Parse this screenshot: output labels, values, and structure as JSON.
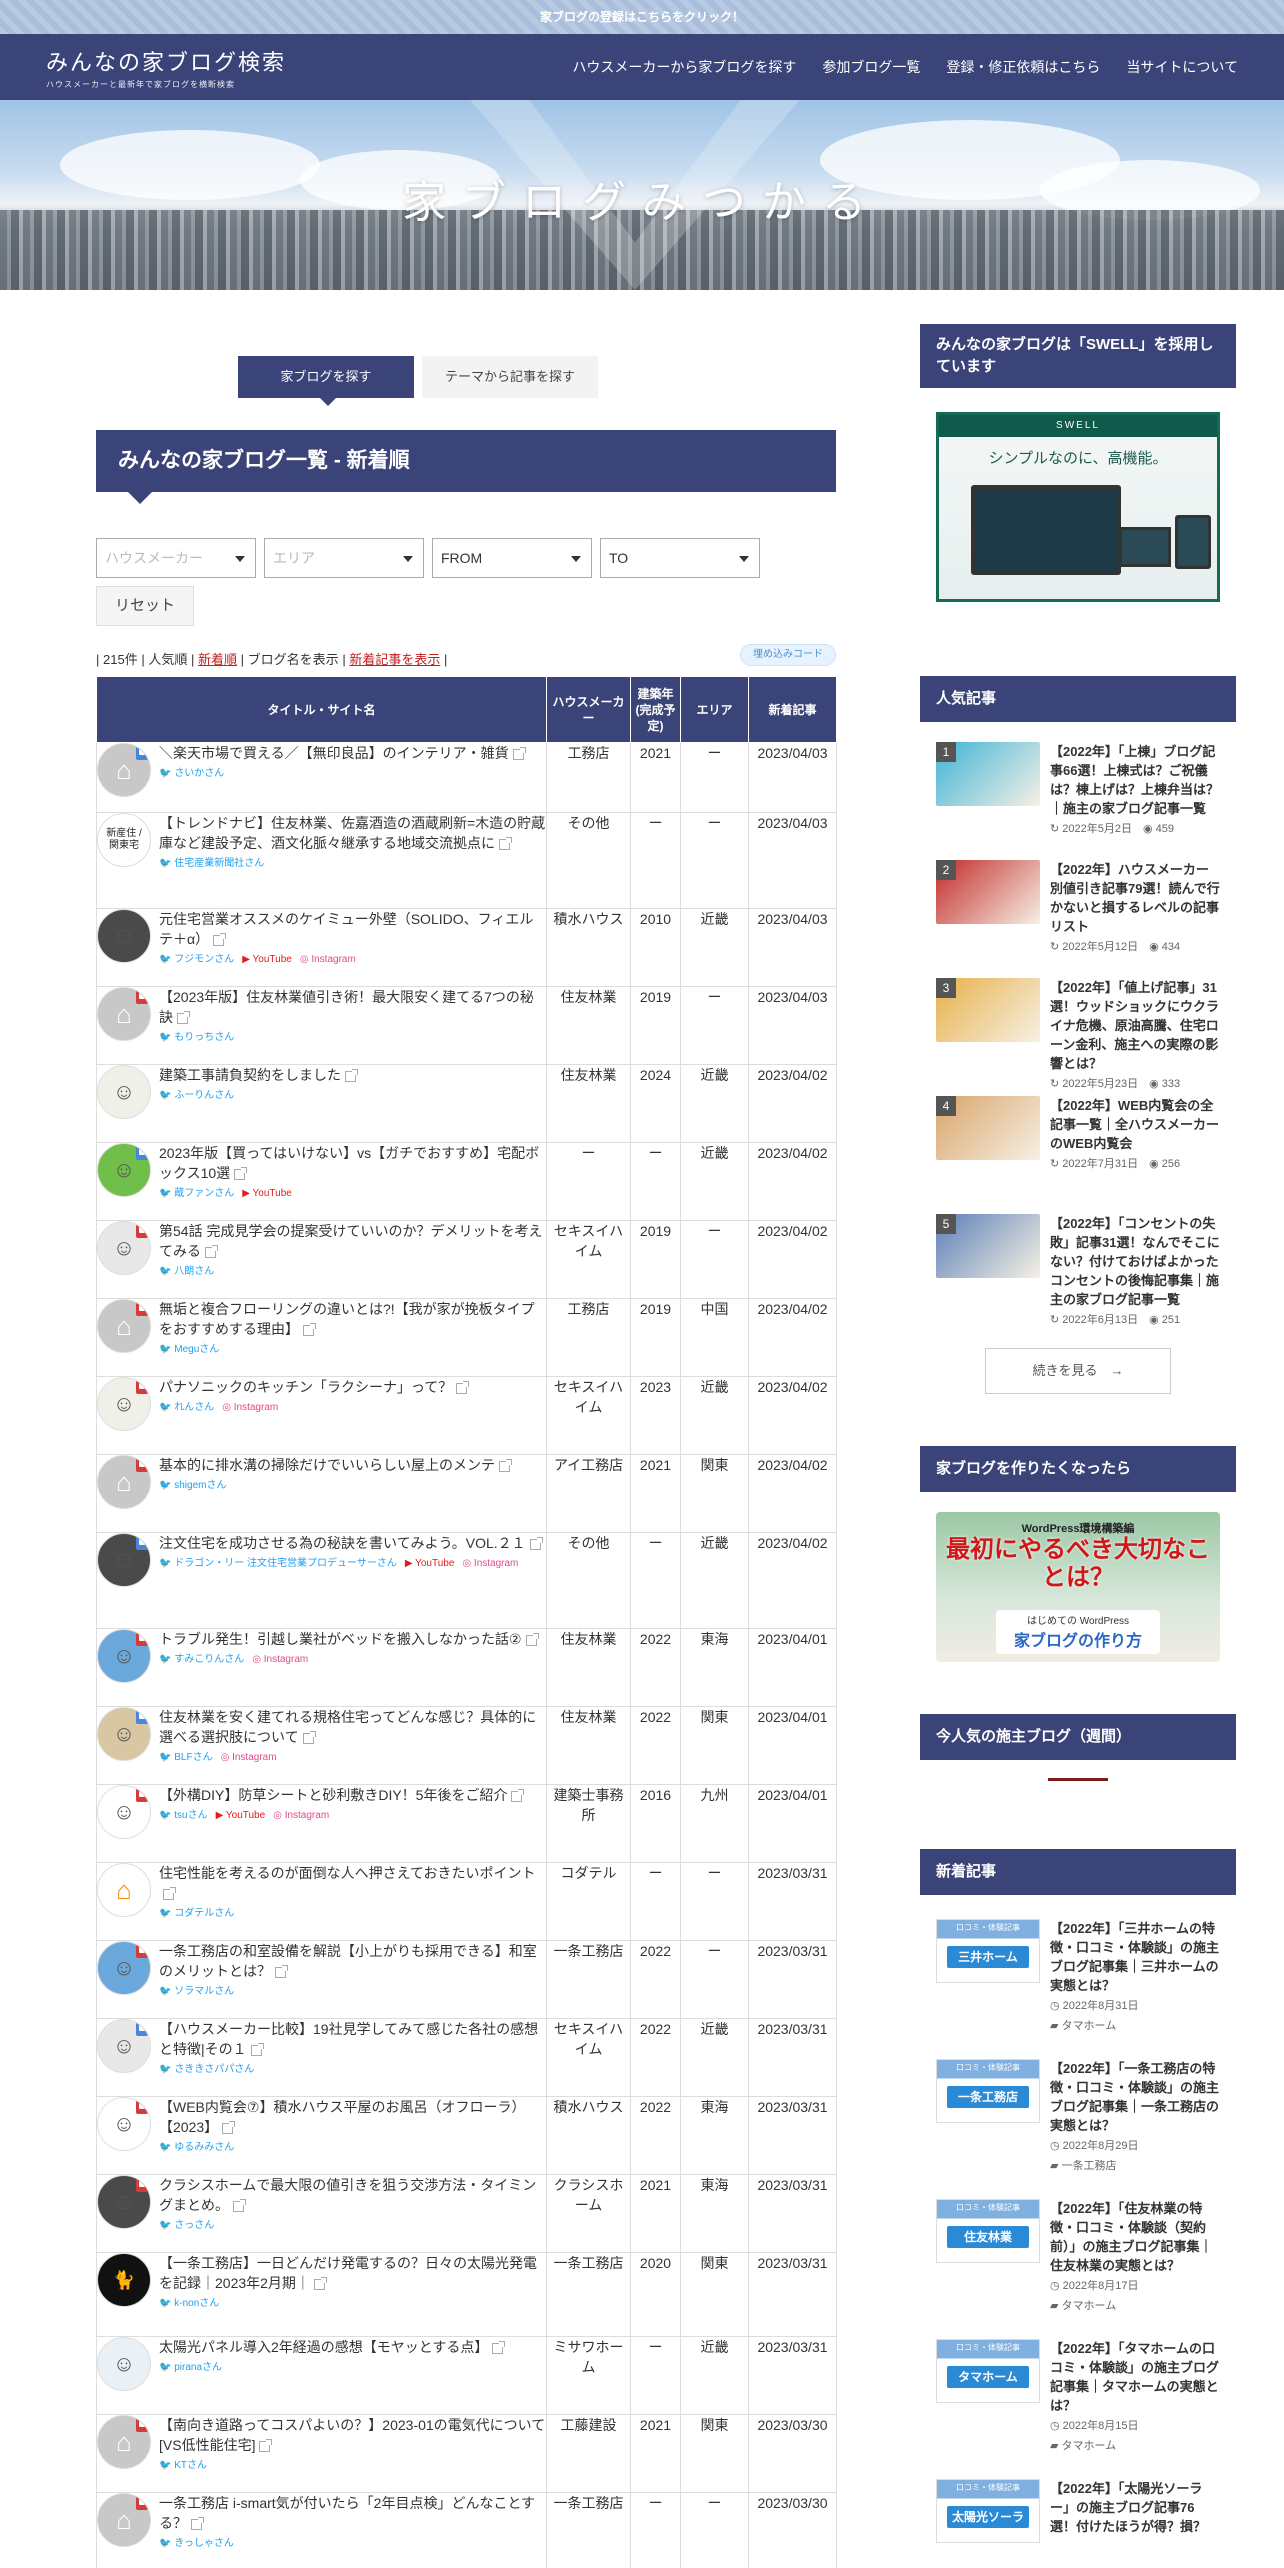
{
  "topbar": {
    "text": "家ブログの登録はこちらをクリック！"
  },
  "header": {
    "logo_main": "みんなの家ブログ検索",
    "logo_sub": "ハウスメーカーと最新年で家ブログを横断検索",
    "nav": [
      "ハウスメーカーから家ブログを探す",
      "参加ブログ一覧",
      "登録・修正依頼はこちら",
      "当サイトについて"
    ]
  },
  "hero": {
    "title": "家ブログみつかる"
  },
  "tabs": {
    "active": "家ブログを探す",
    "inactive": "テーマから記事を探す"
  },
  "section_title": "みんなの家ブログ一覧 - 新着順",
  "filters": {
    "house_maker": "ハウスメーカー",
    "area": "エリア",
    "from": "FROM",
    "to": "TO",
    "reset": "リセット"
  },
  "meta": {
    "count": "215件",
    "sep": "|",
    "popular": "人気順",
    "newest": "新着順",
    "show_blog": "ブログ名を表示",
    "show_new": "新着記事を表示",
    "embed": "埋め込みコード"
  },
  "table": {
    "headers": [
      "タイトル・サイト名",
      "ハウスメーカー",
      "建築年(完成予定)",
      "エリア",
      "新着記事"
    ],
    "rows": [
      {
        "title": "＼楽天市場で買える／【無印良品】のインテリア・雑貨",
        "author": "さいかさん",
        "house": "工務店",
        "year": "2021",
        "area": "ー",
        "date": "2023/04/03",
        "yt": "",
        "ig": "",
        "av": "gray",
        "badge": "blue"
      },
      {
        "title": "【トレンドナビ】住友林業、佐嘉酒造の酒蔵刷新=木造の貯蔵庫など建設予定、酒文化脈々継承する地域交流拠点に",
        "author": "住宅産業新聞社さん",
        "house": "その他",
        "year": "ー",
        "area": "ー",
        "date": "2023/04/03",
        "yt": "",
        "ig": "",
        "av": "text",
        "badge": "",
        "avtext": "新産住 / 関東宅"
      },
      {
        "title": "元住宅営業オススメのケイミュー外壁（SOLIDO、フィエルテ＋α）",
        "author": "フジモンさん",
        "house": "積水ハウス",
        "year": "2010",
        "area": "近畿",
        "date": "2023/04/03",
        "yt": "YouTube",
        "ig": "Instagram",
        "av": "dark",
        "badge": ""
      },
      {
        "title": "【2023年版】住友林業値引き術！最大限安く建てる7つの秘訣",
        "author": "もりっちさん",
        "house": "住友林業",
        "year": "2019",
        "area": "ー",
        "date": "2023/04/03",
        "yt": "",
        "ig": "",
        "av": "gray",
        "badge": "red"
      },
      {
        "title": "建築工事請負契約をしました",
        "author": "ふーりんさん",
        "house": "住友林業",
        "year": "2024",
        "area": "近畿",
        "date": "2023/04/02",
        "yt": "",
        "ig": "",
        "av": "light",
        "badge": ""
      },
      {
        "title": "2023年版【買ってはいけない】vs【ガチでおすすめ】宅配ボックス10選",
        "author": "蔵ファンさん",
        "house": "ー",
        "year": "ー",
        "area": "近畿",
        "date": "2023/04/02",
        "yt": "YouTube",
        "ig": "",
        "av": "green",
        "badge": "blue"
      },
      {
        "title": "第54話 完成見学会の提案受けていいのか？デメリットを考えてみる",
        "author": "八朗さん",
        "house": "セキスイハイム",
        "year": "2019",
        "area": "ー",
        "date": "2023/04/02",
        "yt": "",
        "ig": "",
        "av": "char",
        "badge": "red"
      },
      {
        "title": "無垢と複合フローリングの違いとは?!【我が家が挽板タイプをおすすめする理由】",
        "author": "Meguさん",
        "house": "工務店",
        "year": "2019",
        "area": "中国",
        "date": "2023/04/02",
        "yt": "",
        "ig": "",
        "av": "gray",
        "badge": "red"
      },
      {
        "title": "パナソニックのキッチン「ラクシーナ」って？",
        "author": "れんさん",
        "house": "セキスイハイム",
        "year": "2023",
        "area": "近畿",
        "date": "2023/04/02",
        "yt": "",
        "ig": "Instagram",
        "av": "light",
        "badge": "red"
      },
      {
        "title": "基本的に排水溝の掃除だけでいいらしい屋上のメンテ",
        "author": "shigemさん",
        "house": "アイ工務店",
        "year": "2021",
        "area": "関東",
        "date": "2023/04/02",
        "yt": "",
        "ig": "",
        "av": "gray",
        "badge": "red"
      },
      {
        "title": "注文住宅を成功させる為の秘訣を書いてみよう。VOL.２１",
        "author": "ドラゴン・リー 注文住宅営業プロデューサーさん",
        "house": "その他",
        "year": "ー",
        "area": "近畿",
        "date": "2023/04/02",
        "yt": "YouTube",
        "ig": "Instagram",
        "av": "dark",
        "badge": "blue"
      },
      {
        "title": "トラブル発生！引越し業社がベッドを搬入しなかった話②",
        "author": "すみこりんさん",
        "house": "住友林業",
        "year": "2022",
        "area": "東海",
        "date": "2023/04/01",
        "yt": "",
        "ig": "Instagram",
        "av": "blue",
        "badge": "red"
      },
      {
        "title": "住友林業を安く建てれる規格住宅ってどんな感じ？具体的に選べる選択肢について",
        "author": "BLFさん",
        "house": "住友林業",
        "year": "2022",
        "area": "関東",
        "date": "2023/04/01",
        "yt": "",
        "ig": "Instagram",
        "av": "beige",
        "badge": "blue"
      },
      {
        "title": "【外構DIY】防草シートと砂利敷きDIY！5年後をご紹介",
        "author": "tsuさん",
        "house": "建築士事務所",
        "year": "2016",
        "area": "九州",
        "date": "2023/04/01",
        "yt": "YouTube",
        "ig": "Instagram",
        "av": "white",
        "badge": "red"
      },
      {
        "title": "住宅性能を考えるのが面倒な人へ押さえておきたいポイント",
        "author": "コダテルさん",
        "house": "コダテル",
        "year": "ー",
        "area": "ー",
        "date": "2023/03/31",
        "yt": "",
        "ig": "",
        "av": "orange",
        "badge": ""
      },
      {
        "title": "一条工務店の和室設備を解説【小上がりも採用できる】和室のメリットとは？",
        "author": "ソラマルさん",
        "house": "一条工務店",
        "year": "2022",
        "area": "ー",
        "date": "2023/03/31",
        "yt": "",
        "ig": "",
        "av": "blue",
        "badge": "red"
      },
      {
        "title": "【ハウスメーカー比較】19社見学してみて感じた各社の感想と特徴|その１",
        "author": "さききさパパさん",
        "house": "セキスイハイム",
        "year": "2022",
        "area": "近畿",
        "date": "2023/03/31",
        "yt": "",
        "ig": "",
        "av": "char",
        "badge": "blue"
      },
      {
        "title": "【WEB内覧会⑦】積水ハウス平屋のお風呂（オフローラ）【2023】",
        "author": "ゆるみみさん",
        "house": "積水ハウス",
        "year": "2022",
        "area": "東海",
        "date": "2023/03/31",
        "yt": "",
        "ig": "",
        "av": "white",
        "badge": "red"
      },
      {
        "title": "クラシスホームで最大限の値引きを狙う交渉方法・タイミングまとめ。",
        "author": "さっさん",
        "house": "クラシスホーム",
        "year": "2021",
        "area": "東海",
        "date": "2023/03/31",
        "yt": "",
        "ig": "",
        "av": "dark",
        "badge": "red"
      },
      {
        "title": "【一条工務店】一日どんだけ発電するの？日々の太陽光発電を記録｜2023年2月期｜",
        "author": "k-nonさん",
        "house": "一条工務店",
        "year": "2020",
        "area": "関東",
        "date": "2023/03/31",
        "yt": "",
        "ig": "",
        "av": "black",
        "badge": ""
      },
      {
        "title": "太陽光パネル導入2年経過の感想【モヤッとする点】",
        "author": "piranaさん",
        "house": "ミサワホーム",
        "year": "ー",
        "area": "近畿",
        "date": "2023/03/31",
        "yt": "",
        "ig": "",
        "av": "bird",
        "badge": ""
      },
      {
        "title": "【南向き道路ってコスパよいの？】2023-01の電気代について [VS低性能住宅]",
        "author": "KTさん",
        "house": "工藤建設",
        "year": "2021",
        "area": "関東",
        "date": "2023/03/30",
        "yt": "",
        "ig": "",
        "av": "gray",
        "badge": "red"
      },
      {
        "title": "一条工務店 i-smart気が付いたら「2年目点検」どんなことする？",
        "author": "きっしゃさん",
        "house": "一条工務店",
        "year": "ー",
        "area": "ー",
        "date": "2023/03/30",
        "yt": "",
        "ig": "",
        "av": "gray",
        "badge": "red"
      }
    ]
  },
  "sidebar": {
    "swell_head": "みんなの家ブログは「SWELL」を採用しています",
    "swell_brand": "SWELL",
    "swell_tag": "シンプルなのに、高機能。",
    "popular_head": "人気記事",
    "popular": [
      {
        "num": "1",
        "title": "【2022年】「上棟」ブログ記事66選！上棟式は？ご祝儀は？棟上げは？上棟弁当は？｜施主の家ブログ記事一覧",
        "date": "2022年5月2日",
        "views": "459",
        "color": "#3fb4d6"
      },
      {
        "num": "2",
        "title": "【2022年】ハウスメーカー別値引き記事79選！読んで行かないと損するレベルの記事リスト",
        "date": "2022年5月12日",
        "views": "434",
        "color": "#c22a2a"
      },
      {
        "num": "3",
        "title": "【2022年】「値上げ記事」31選！ウッドショックにウクライナ危機、原油高騰、住宅ローン金利、施主への実際の影響とは？",
        "date": "2022年5月23日",
        "views": "333",
        "color": "#e8b04a"
      },
      {
        "num": "4",
        "title": "【2022年】WEB内覧会の全記事一覧｜全ハウスメーカーのWEB内覧会",
        "date": "2022年7月31日",
        "views": "256",
        "color": "#d9a46a"
      },
      {
        "num": "5",
        "title": "【2022年】「コンセントの失敗」記事31選！なんでそこにない？付けておけばよかったコンセントの後悔記事集｜施主の家ブログ記事一覧",
        "date": "2022年6月13日",
        "views": "251",
        "color": "#5a7fb8"
      }
    ],
    "more": "続きを見る",
    "wp_head": "家ブログを作りたくなったら",
    "wp_small": "WordPress環境構築編",
    "wp_big": "最初にやるべき大切なことは？",
    "wp_sub": "はじめての WordPress",
    "wp_title": "家ブログの作り方",
    "weekly_head": "今人気の施主ブログ（週間）",
    "new_head": "新着記事",
    "new": [
      {
        "label": "三井ホーム",
        "title": "【2022年】「三井ホームの特徴・口コミ・体験談」の施主ブログ記事集｜三井ホームの実態とは？",
        "date": "2022年8月31日",
        "cat": "タマホーム",
        "color": "#2a8ad6"
      },
      {
        "label": "一条工務店",
        "title": "【2022年】「一条工務店の特徴・口コミ・体験談」の施主ブログ記事集｜一条工務店の実態とは？",
        "date": "2022年8月29日",
        "cat": "一条工務店",
        "color": "#2a8ad6"
      },
      {
        "label": "住友林業",
        "title": "【2022年】「住友林業の特徴・口コミ・体験談（契約前）」の施主ブログ記事集｜住友林業の実態とは？",
        "date": "2022年8月17日",
        "cat": "タマホーム",
        "color": "#2a8ad6"
      },
      {
        "label": "タマホーム",
        "title": "【2022年】「タマホームの口コミ・体験談」の施主ブログ記事集｜タマホームの実態とは？",
        "date": "2022年8月15日",
        "cat": "タマホーム",
        "color": "#2a8ad6"
      },
      {
        "label": "太陽光ソーラー",
        "title": "【2022年】「太陽光ソーラー」の施主ブログ記事76選！付けたほうが得？損？",
        "date": "",
        "cat": "",
        "color": "#2a8ad6"
      }
    ],
    "new_thumb_top": "口コミ・体験記事"
  }
}
